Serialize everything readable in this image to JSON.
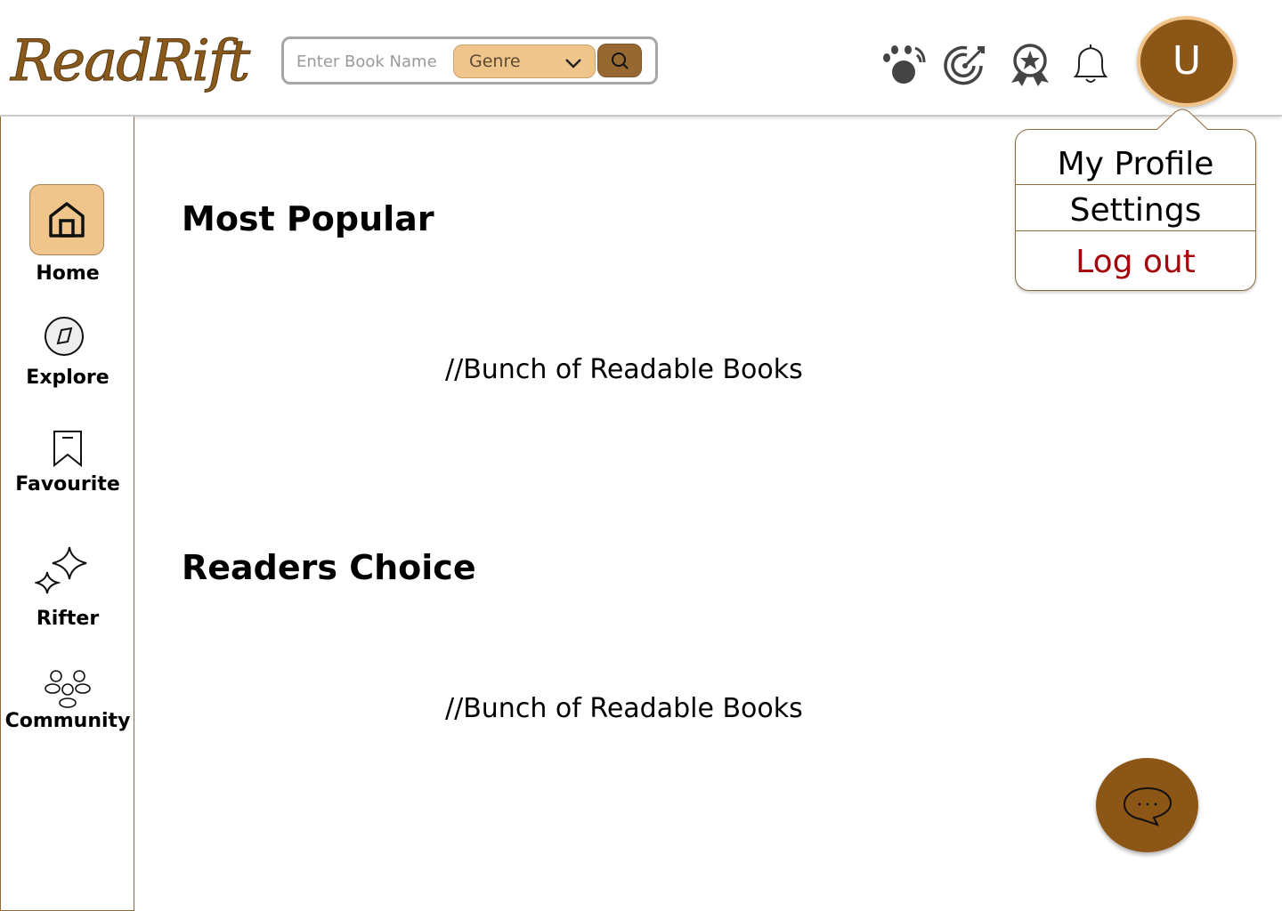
{
  "app": {
    "logo_text": "ReadRift"
  },
  "search": {
    "placeholder": "Enter Book Name",
    "genre_selected": "Genre"
  },
  "header_icons": [
    "cat-paw-icon",
    "target-icon",
    "award-badge-icon",
    "bell-icon"
  ],
  "user": {
    "avatar_initial": "U"
  },
  "profile_menu": {
    "items": [
      {
        "label": "My Profile"
      },
      {
        "label": "Settings"
      },
      {
        "label": "Log out",
        "color": "#a4060b"
      }
    ]
  },
  "sidebar": {
    "items": [
      {
        "label": "Home",
        "icon": "home-icon",
        "active": true
      },
      {
        "label": "Explore",
        "icon": "compass-icon"
      },
      {
        "label": "Favourite",
        "icon": "bookmark-icon"
      },
      {
        "label": "Rifter",
        "icon": "sparkles-icon"
      },
      {
        "label": "Community",
        "icon": "people-icon"
      }
    ]
  },
  "main": {
    "sections": [
      {
        "title": "Most Popular",
        "content": "//Bunch of Readable Books"
      },
      {
        "title": "Readers Choice",
        "content": "//Bunch of Readable Books"
      }
    ]
  },
  "colors": {
    "brand_brown": "#8c5617",
    "accent_tan": "#f0c58c",
    "logout_red": "#a4060b"
  }
}
